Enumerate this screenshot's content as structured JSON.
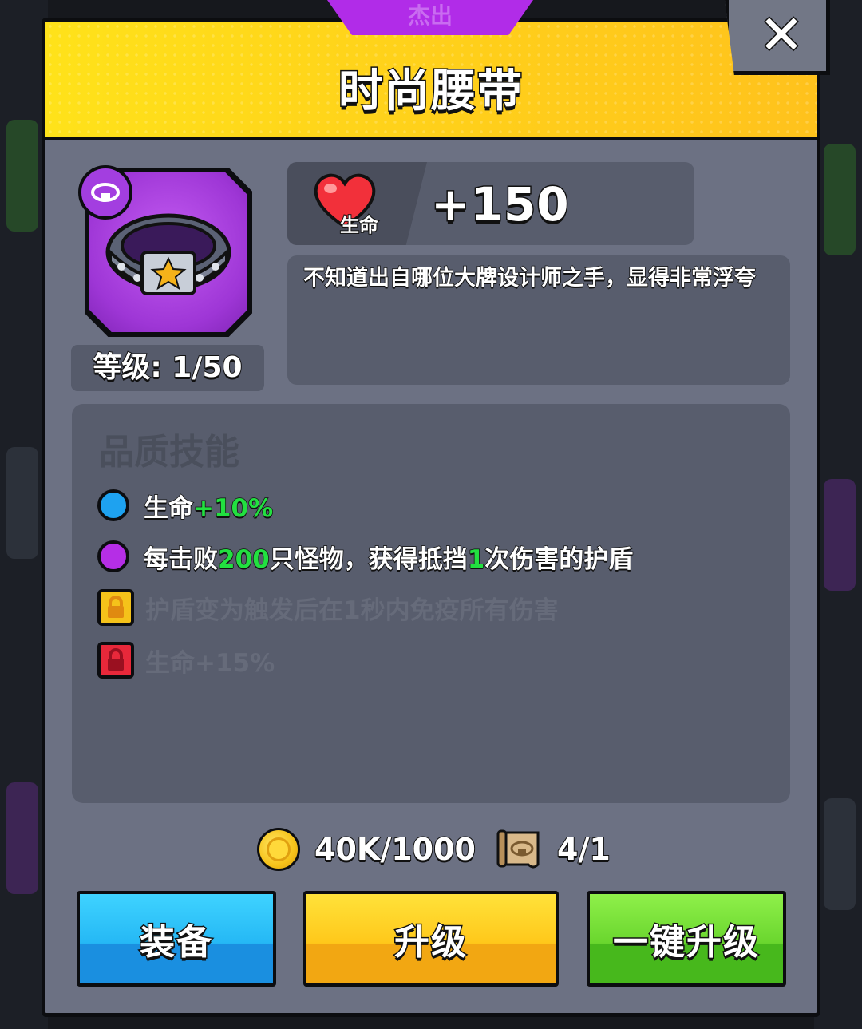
{
  "item": {
    "rarity": "杰出",
    "name": "时尚腰带",
    "level_text": "等级: 1/50",
    "description": "不知道出自哪位大牌设计师之手，显得非常浮夸"
  },
  "stat": {
    "icon_label": "生命",
    "value": "+150"
  },
  "skills": {
    "title": "品质技能",
    "rows": [
      {
        "prefix": "生命",
        "highlight": "+10%",
        "mid": "",
        "highlight2": "",
        "suffix": "",
        "icon": "blue-dot",
        "locked": false
      },
      {
        "prefix": "每击败",
        "highlight": "200",
        "mid": "只怪物，获得抵挡",
        "highlight2": "1",
        "suffix": "次伤害的护盾",
        "icon": "purple-dot",
        "locked": false
      },
      {
        "text": "护盾变为触发后在1秒内免疫所有伤害",
        "icon": "gold-lock",
        "locked": true
      },
      {
        "text": "生命+15%",
        "icon": "red-lock",
        "locked": true
      }
    ]
  },
  "costs": {
    "gold": "40K/1000",
    "scroll": "4/1"
  },
  "buttons": {
    "equip": "装备",
    "upgrade": "升级",
    "upgrade_all": "一键升级"
  },
  "colors": {
    "header": "#ffd21a",
    "rarity": "#b12ce8",
    "highlight_green": "#22e040",
    "equip_blue": "#25b8f5",
    "upgrade_yellow": "#ffc81a",
    "upgrade_all_green": "#6ad62e"
  }
}
